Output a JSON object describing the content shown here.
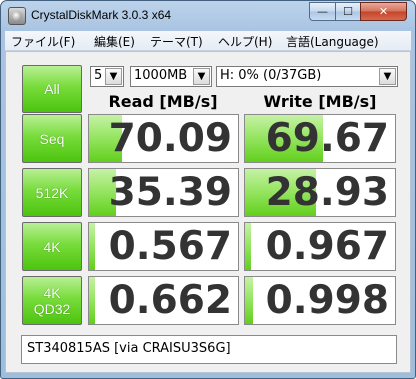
{
  "window": {
    "title": "CrystalDiskMark 3.0.3 x64",
    "buttons": {
      "minimize": "—",
      "maximize": "☐",
      "close": "✕"
    }
  },
  "menu": [
    "ファイル(F)",
    "編集(E)",
    "テーマ(T)",
    "ヘルプ(H)",
    "言語(Language)"
  ],
  "controls": {
    "all_label": "All",
    "runs": "5",
    "size": "1000MB",
    "drive": "H: 0% (0/37GB)"
  },
  "columns": {
    "read": "Read [MB/s]",
    "write": "Write [MB/s]"
  },
  "rows": [
    {
      "label": "Seq",
      "label2": "",
      "read": "70.09",
      "write": "69.67",
      "read_fill": 0.22,
      "write_fill": 0.52
    },
    {
      "label": "512K",
      "label2": "",
      "read": "35.39",
      "write": "28.93",
      "read_fill": 0.18,
      "write_fill": 0.47
    },
    {
      "label": "4K",
      "label2": "",
      "read": "0.567",
      "write": "0.967",
      "read_fill": 0.04,
      "write_fill": 0.04
    },
    {
      "label": "4K",
      "label2": "QD32",
      "read": "0.662",
      "write": "0.998",
      "read_fill": 0.04,
      "write_fill": 0.05
    }
  ],
  "status": "ST340815AS [via CRAISU3S6G]",
  "colors": {
    "accent_green": "#62cf1d",
    "window_frame": "#a9c4e2"
  }
}
